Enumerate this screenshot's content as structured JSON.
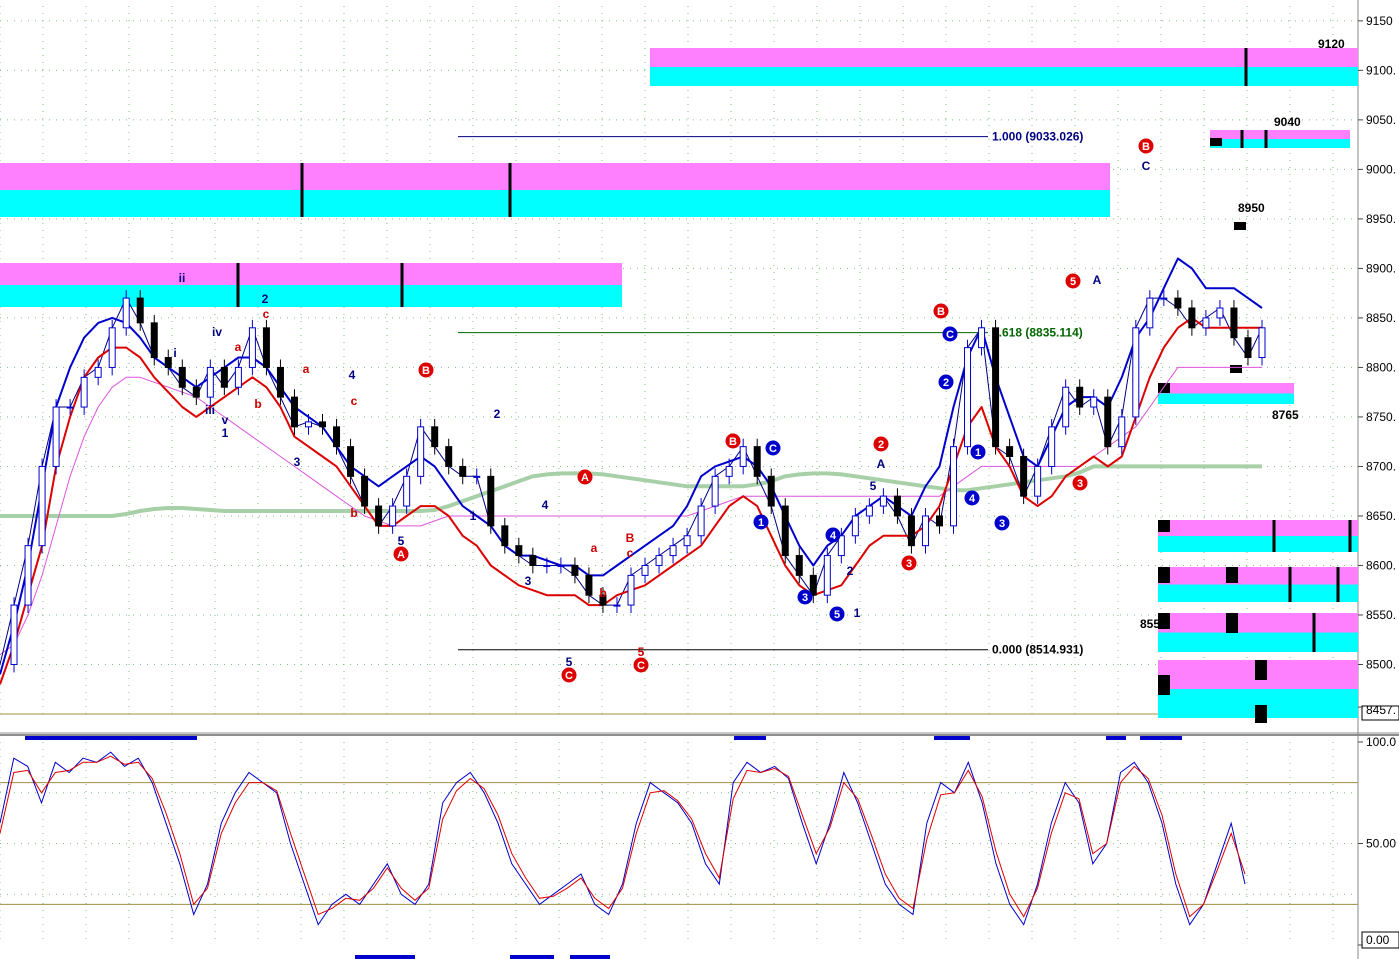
{
  "chart_data": [
    {
      "type": "candlestick",
      "panel": "price",
      "y_ticks": [
        "9150",
        "9100.",
        "9050.",
        "9000.",
        "8950.",
        "8900.",
        "8850.",
        "8800.",
        "8750.",
        "8700.",
        "8650.",
        "8600.",
        "8550.",
        "8500.",
        "8457."
      ],
      "ylim": [
        8450,
        9165
      ],
      "fib_levels": [
        {
          "label": "1.000 (9033.026)",
          "value": 9033.026
        },
        {
          "label": "0.618 (8835.114)",
          "value": 8835.114
        },
        {
          "label": "0.000 (8514.931)",
          "value": 8514.931
        }
      ],
      "target_labels": [
        "9120",
        "9040",
        "8950",
        "8765",
        "855"
      ],
      "series": [
        {
          "name": "close",
          "color": "#000080",
          "values": [
            8500,
            8560,
            8620,
            8700,
            8760,
            8760,
            8790,
            8800,
            8840,
            8870,
            8845,
            8810,
            8800,
            8780,
            8770,
            8800,
            8780,
            8800,
            8840,
            8800,
            8770,
            8740,
            8745,
            8740,
            8720,
            8690,
            8660,
            8640,
            8660,
            8690,
            8740,
            8720,
            8700,
            8690,
            8690,
            8640,
            8620,
            8610,
            8600,
            8600,
            8600,
            8590,
            8570,
            8560,
            8560,
            8590,
            8600,
            8610,
            8620,
            8630,
            8660,
            8690,
            8700,
            8720,
            8690,
            8660,
            8610,
            8590,
            8570,
            8610,
            8630,
            8650,
            8660,
            8670,
            8650,
            8620,
            8650,
            8640,
            8720,
            8820,
            8840,
            8720,
            8710,
            8670,
            8700,
            8740,
            8780,
            8760,
            8770,
            8720,
            8750,
            8840,
            8870,
            8870,
            8860,
            8840,
            8850,
            8860,
            8830,
            8810,
            8840
          ]
        },
        {
          "name": "upper band",
          "color": "#0000cc",
          "values": [
            8490,
            8540,
            8600,
            8680,
            8760,
            8800,
            8830,
            8845,
            8850,
            8845,
            8830,
            8810,
            8800,
            8790,
            8780,
            8790,
            8800,
            8810,
            8810,
            8800,
            8780,
            8760,
            8750,
            8740,
            8720,
            8700,
            8690,
            8680,
            8690,
            8700,
            8710,
            8700,
            8680,
            8660,
            8650,
            8640,
            8620,
            8610,
            8610,
            8605,
            8600,
            8600,
            8590,
            8590,
            8600,
            8610,
            8620,
            8630,
            8640,
            8660,
            8690,
            8700,
            8705,
            8710,
            8700,
            8680,
            8650,
            8620,
            8600,
            8620,
            8630,
            8650,
            8660,
            8670,
            8660,
            8650,
            8680,
            8700,
            8760,
            8810,
            8840,
            8790,
            8750,
            8710,
            8700,
            8730,
            8760,
            8770,
            8770,
            8760,
            8790,
            8830,
            8850,
            8880,
            8910,
            8900,
            8880,
            8880,
            8880,
            8870,
            8860
          ]
        },
        {
          "name": "lower band",
          "color": "#dd0000",
          "values": [
            8480,
            8520,
            8570,
            8620,
            8700,
            8750,
            8790,
            8810,
            8820,
            8820,
            8810,
            8790,
            8775,
            8760,
            8750,
            8760,
            8770,
            8780,
            8790,
            8780,
            8760,
            8730,
            8720,
            8710,
            8700,
            8680,
            8660,
            8640,
            8640,
            8650,
            8660,
            8660,
            8650,
            8630,
            8620,
            8600,
            8590,
            8580,
            8575,
            8570,
            8570,
            8570,
            8560,
            8560,
            8570,
            8575,
            8580,
            8590,
            8600,
            8610,
            8620,
            8640,
            8660,
            8670,
            8660,
            8630,
            8600,
            8580,
            8570,
            8575,
            8580,
            8600,
            8620,
            8630,
            8630,
            8630,
            8640,
            8660,
            8700,
            8740,
            8760,
            8720,
            8700,
            8670,
            8660,
            8670,
            8690,
            8700,
            8710,
            8700,
            8710,
            8750,
            8790,
            8820,
            8840,
            8850,
            8840,
            8840,
            8840,
            8840,
            8840
          ]
        },
        {
          "name": "slow average",
          "color": "#dd55dd",
          "values": [
            8510,
            8520,
            8550,
            8590,
            8640,
            8690,
            8730,
            8760,
            8780,
            8790,
            8790,
            8785,
            8780,
            8775,
            8770,
            8760,
            8750,
            8740,
            8730,
            8720,
            8710,
            8700,
            8690,
            8680,
            8670,
            8660,
            8650,
            8645,
            8640,
            8640,
            8640,
            8645,
            8650,
            8650,
            8650,
            8650,
            8650,
            8650,
            8650,
            8650,
            8650,
            8650,
            8650,
            8650,
            8650,
            8650,
            8650,
            8650,
            8650,
            8650,
            8655,
            8660,
            8665,
            8670,
            8670,
            8670,
            8670,
            8670,
            8670,
            8670,
            8670,
            8670,
            8670,
            8670,
            8670,
            8670,
            8670,
            8670,
            8680,
            8690,
            8700,
            8700,
            8700,
            8700,
            8700,
            8700,
            8700,
            8700,
            8710,
            8720,
            8730,
            8740,
            8760,
            8780,
            8800,
            8800,
            8800,
            8800,
            8800,
            8800,
            8800
          ]
        },
        {
          "name": "long average",
          "color": "#a8d0a8",
          "values": [
            8650,
            8650,
            8650,
            8650,
            8650,
            8650,
            8650,
            8650,
            8650,
            8652,
            8655,
            8657,
            8658,
            8658,
            8657,
            8656,
            8655,
            8655,
            8655,
            8655,
            8655,
            8655,
            8655,
            8655,
            8655,
            8655,
            8655,
            8655,
            8655,
            8655,
            8655,
            8656,
            8660,
            8665,
            8670,
            8675,
            8680,
            8685,
            8690,
            8692,
            8693,
            8693,
            8693,
            8692,
            8690,
            8688,
            8686,
            8684,
            8682,
            8680,
            8680,
            8680,
            8680,
            8680,
            8682,
            8685,
            8690,
            8692,
            8693,
            8693,
            8692,
            8690,
            8688,
            8686,
            8684,
            8682,
            8680,
            8678,
            8676,
            8676,
            8678,
            8680,
            8682,
            8684,
            8686,
            8688,
            8690,
            8694,
            8700,
            8700,
            8700,
            8700,
            8700,
            8700,
            8700,
            8700,
            8700,
            8700,
            8700,
            8700,
            8700
          ]
        }
      ]
    },
    {
      "type": "line",
      "panel": "stochastic",
      "y_ticks": [
        "100.0",
        "50.00",
        "0.00"
      ],
      "ylim": [
        0,
        100
      ],
      "reference_lines": [
        80,
        20
      ],
      "series": [
        {
          "name": "%K",
          "color": "#0000cc",
          "values": [
            60,
            92,
            88,
            70,
            90,
            85,
            92,
            90,
            95,
            88,
            92,
            80,
            60,
            40,
            15,
            30,
            60,
            75,
            85,
            80,
            75,
            50,
            30,
            10,
            20,
            25,
            20,
            30,
            40,
            25,
            20,
            30,
            70,
            80,
            85,
            75,
            60,
            40,
            30,
            20,
            25,
            30,
            35,
            20,
            15,
            30,
            60,
            80,
            75,
            70,
            60,
            40,
            30,
            80,
            90,
            85,
            88,
            82,
            60,
            40,
            60,
            85,
            70,
            50,
            30,
            20,
            15,
            60,
            80,
            75,
            90,
            70,
            40,
            20,
            10,
            30,
            60,
            80,
            70,
            40,
            50,
            85,
            90,
            80,
            60,
            30,
            10,
            20,
            40,
            60,
            30
          ]
        },
        {
          "name": "%D",
          "color": "#dd0000",
          "values": [
            55,
            85,
            86,
            75,
            85,
            86,
            90,
            90,
            93,
            89,
            90,
            82,
            65,
            45,
            20,
            28,
            55,
            70,
            80,
            80,
            76,
            55,
            35,
            15,
            18,
            23,
            22,
            28,
            38,
            28,
            22,
            28,
            62,
            76,
            82,
            77,
            64,
            45,
            33,
            23,
            24,
            28,
            33,
            23,
            18,
            28,
            55,
            75,
            76,
            71,
            62,
            45,
            33,
            72,
            86,
            85,
            87,
            83,
            64,
            45,
            58,
            80,
            72,
            54,
            35,
            23,
            18,
            52,
            74,
            75,
            86,
            73,
            46,
            25,
            14,
            28,
            55,
            75,
            72,
            45,
            50,
            80,
            88,
            82,
            64,
            35,
            14,
            20,
            37,
            55,
            35
          ]
        }
      ]
    }
  ],
  "wave_labels": {
    "price": [
      "ii",
      "iv",
      "i",
      "iii",
      "v",
      "1",
      "2",
      "c",
      "a",
      "b",
      "3",
      "4",
      "a",
      "c",
      "b",
      "5",
      "A",
      "B",
      "2",
      "1",
      "4",
      "3",
      "5",
      "C",
      "A",
      "b",
      "a",
      "c",
      "B",
      "5",
      "C",
      "B",
      "C",
      "1",
      "2",
      "3",
      "4",
      "5",
      "1",
      "2",
      "A",
      "5",
      "3",
      "B",
      "C",
      "2",
      "1",
      "4",
      "3",
      "5",
      "A",
      "3",
      "B",
      "C",
      "5"
    ]
  },
  "colors": {
    "zone_top": "#ff80ff",
    "zone_bottom": "#00ffff",
    "grid_dot": "#7fc07f",
    "fib_line_high": "#000080",
    "fib_line_mid": "#006600",
    "fib_line_low": "#000000",
    "reference_line": "#a09040",
    "marker_fill": "#0000cc"
  }
}
